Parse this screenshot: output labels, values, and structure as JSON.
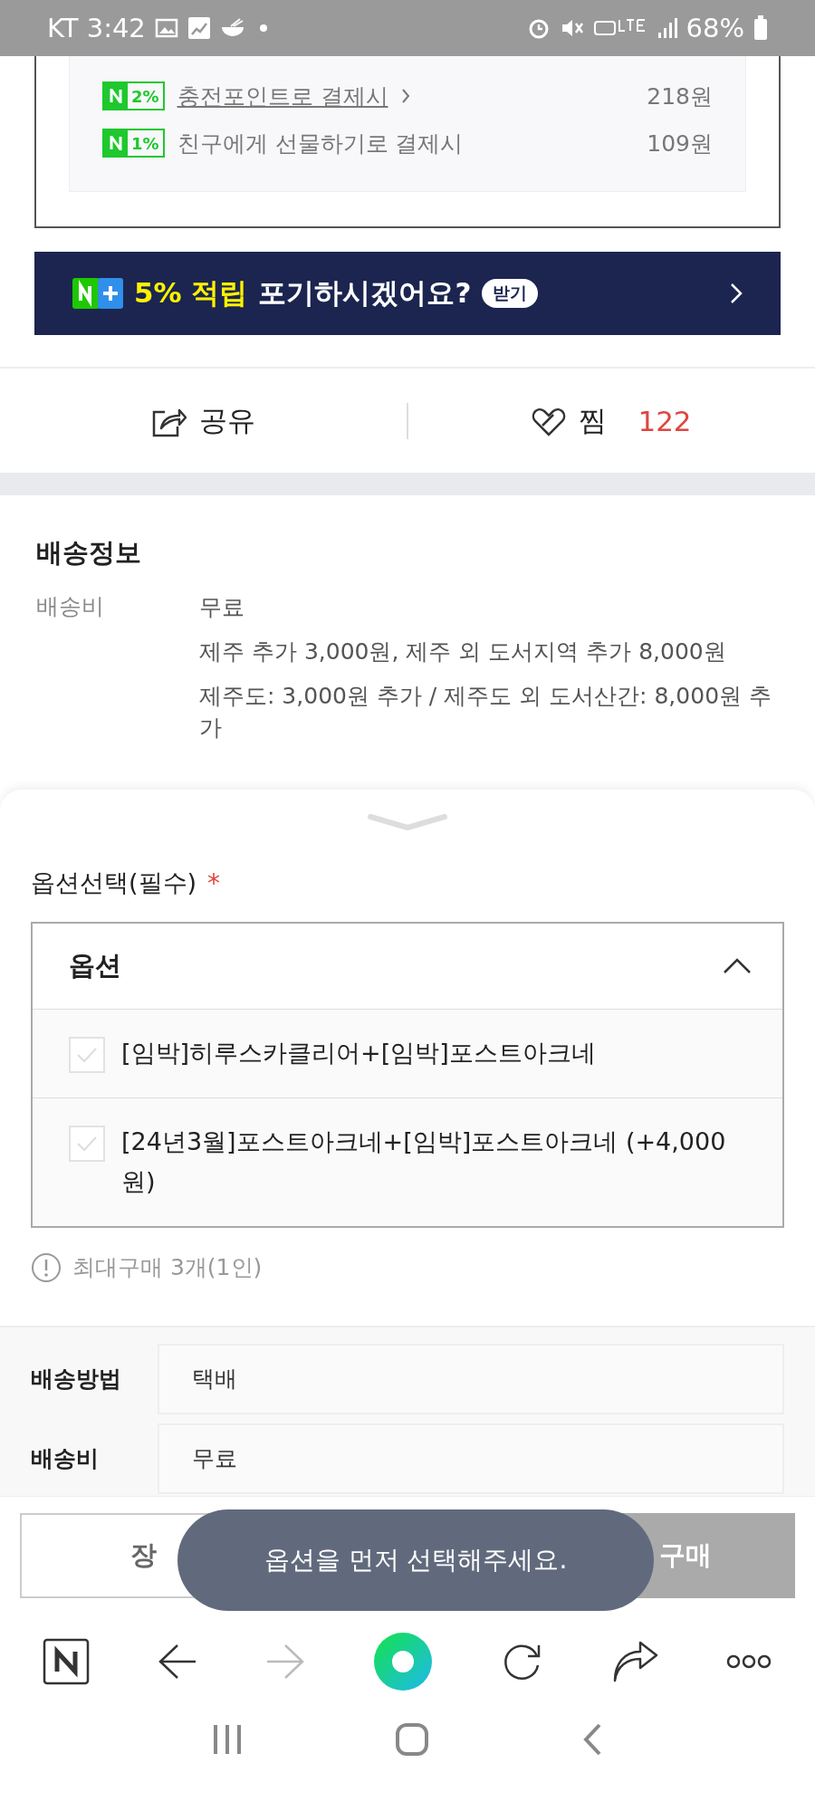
{
  "status_bar": {
    "carrier_time": "KT 3:42",
    "battery": "68%"
  },
  "payback_rows": [
    {
      "badge": "2%",
      "label": "충전포인트로 결제시",
      "linked": true,
      "amount": "218원"
    },
    {
      "badge": "1%",
      "label": "친구에게 선물하기로 결제시",
      "linked": false,
      "amount": "109원"
    }
  ],
  "banner": {
    "highlight": "5% 적립",
    "text": "포기하시겠어요?",
    "pill": "받기"
  },
  "actions": {
    "share": "공유",
    "like": "찜",
    "like_count": "122"
  },
  "shipping_info": {
    "title": "배송정보",
    "label": "배송비",
    "lines": [
      "무료",
      "제주 추가 3,000원, 제주 외 도서지역 추가 8,000원",
      "제주도: 3,000원 추가 / 제주도 외 도서산간: 8,000원 추가"
    ]
  },
  "option_sheet": {
    "title": "옵션선택(필수)",
    "required_mark": "*",
    "dropdown": {
      "label": "옵션",
      "expanded": true
    },
    "options": [
      {
        "label": "[임박]히루스카클리어+[임박]포스트아크네",
        "checked": false
      },
      {
        "label": "[24년3월]포스트아크네+[임박]포스트아크네 (+4,000원)",
        "checked": false
      }
    ],
    "note": "최대구매 3개(1인)",
    "fields": [
      {
        "label": "배송방법",
        "value": "택배"
      },
      {
        "label": "배송비",
        "value": "무료"
      }
    ]
  },
  "buttons": [
    {
      "label": "장",
      "disabled": false
    },
    {
      "label": "구매",
      "disabled": true
    }
  ],
  "toast": "옵션을 먼저 선택해주세요."
}
